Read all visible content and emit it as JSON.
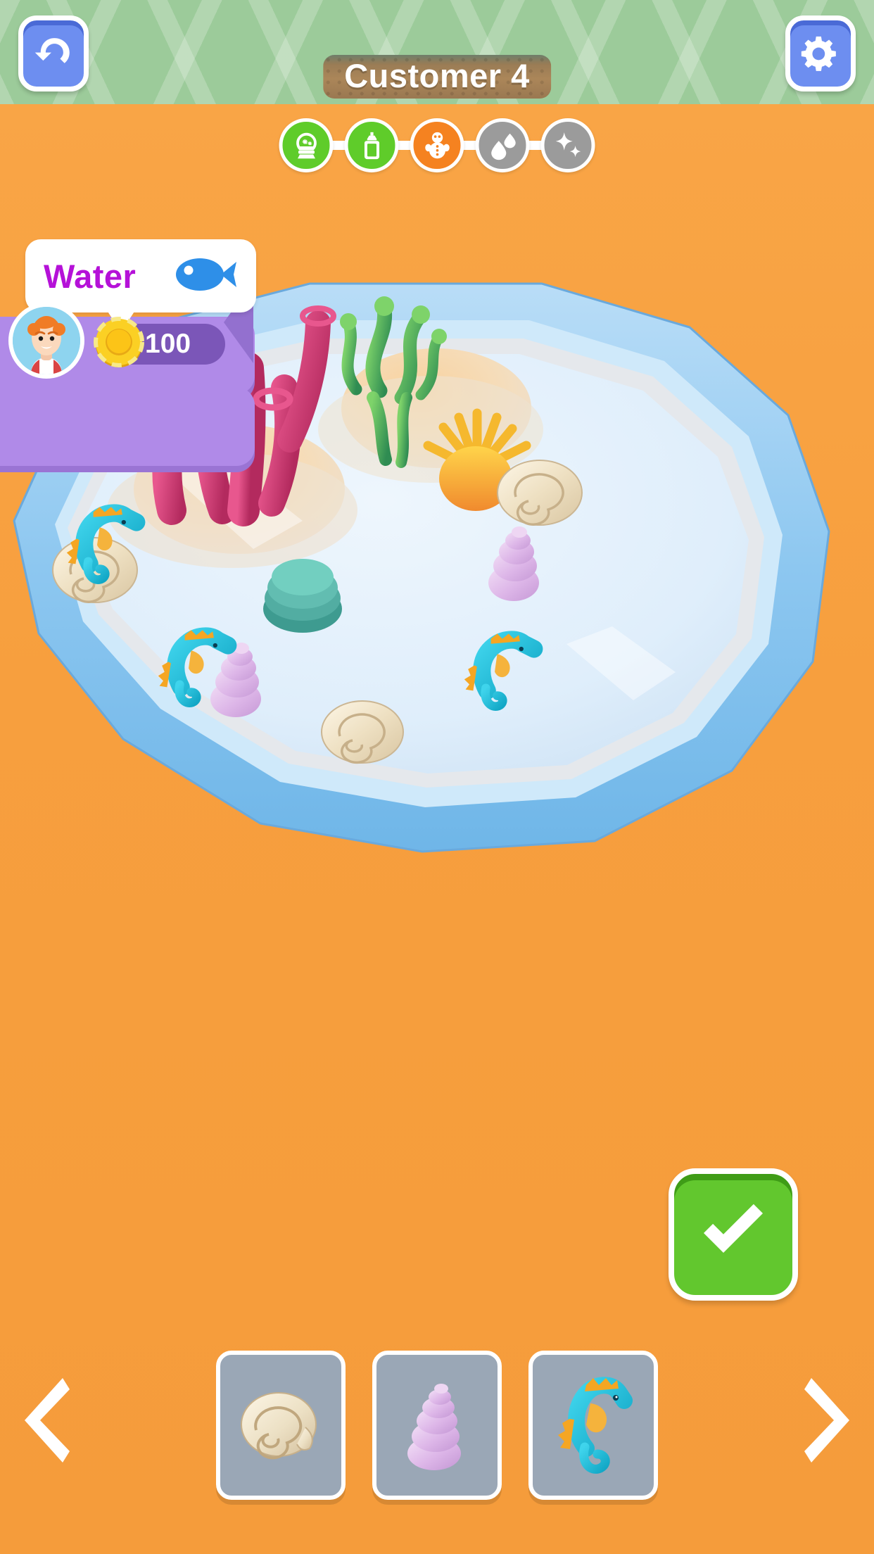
{
  "theme": {
    "floor_color": "#f79f3e",
    "wall_color": "#9ccb9a",
    "accent_blue": "#6d8ef0",
    "accent_green": "#62c72e",
    "panel_purple": "#b08ae8",
    "bubble_text_color": "#b511d8",
    "coin_color": "#f5c518",
    "step_done_color": "#5fcc2a",
    "step_active_color": "#f58220",
    "step_pending_color": "#9b9b9b"
  },
  "header": {
    "title": "Customer 4",
    "undo_button": {
      "icon": "undo-icon",
      "label": "Undo"
    },
    "settings_button": {
      "icon": "gear-icon",
      "label": "Settings"
    }
  },
  "steps": [
    {
      "icon": "snow-globe-icon",
      "label": "Snow Globe",
      "state": "done"
    },
    {
      "icon": "glue-bottle-icon",
      "label": "Glue",
      "state": "done"
    },
    {
      "icon": "snowman-icon",
      "label": "Figure",
      "state": "active"
    },
    {
      "icon": "water-drop-icon",
      "label": "Water",
      "state": "pending"
    },
    {
      "icon": "sparkle-icon",
      "label": "Sparkle",
      "state": "pending"
    }
  ],
  "customer": {
    "request_text": "Water",
    "request_icon": "fish-icon",
    "avatar": "customer-avatar",
    "coin_icon": "coin-icon",
    "coin_amount": "100"
  },
  "tank": {
    "label": "Aquarium Bowl",
    "decor": [
      {
        "name": "pink-tube-coral",
        "color": "#d6447e"
      },
      {
        "name": "green-seaweed",
        "color": "#46b06a"
      },
      {
        "name": "yellow-anemone",
        "color": "#f5c518"
      },
      {
        "name": "teal-rock",
        "color": "#57b9ac"
      }
    ],
    "creatures": [
      {
        "name": "seahorse",
        "color": "#22c0de",
        "count": "3"
      },
      {
        "name": "spiral-shell",
        "color": "#efe3c8",
        "count": "3"
      },
      {
        "name": "conch-shell",
        "color": "#e0b6e8",
        "count": "2"
      }
    ]
  },
  "confirm": {
    "icon": "check-icon",
    "label": "Confirm"
  },
  "tray": {
    "prev_label": "Previous",
    "next_label": "Next",
    "items": [
      {
        "name": "spiral-shell-item",
        "label": "Spiral Shell",
        "color": "#efe3c8"
      },
      {
        "name": "conch-shell-item",
        "label": "Conch Shell",
        "color": "#e0b6e8"
      },
      {
        "name": "seahorse-item",
        "label": "Seahorse",
        "color": "#22c0de"
      }
    ]
  }
}
